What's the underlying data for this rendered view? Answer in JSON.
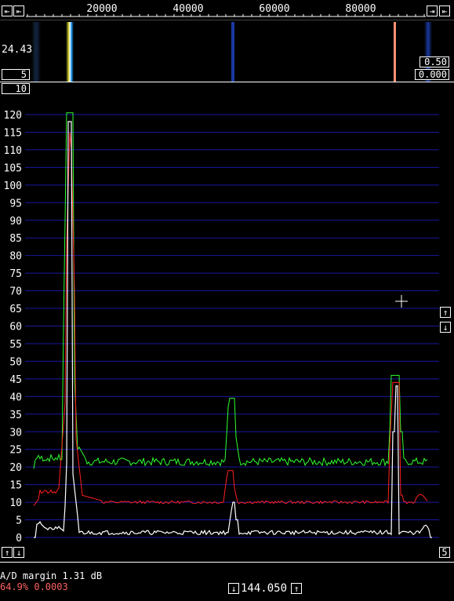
{
  "header": {
    "freq_ticks": [
      "20000",
      "40000",
      "60000",
      "80000"
    ],
    "left_buttons": [
      "⇤",
      "⇤"
    ],
    "right_buttons": [
      "⇥",
      "⇤"
    ]
  },
  "waterfall": {
    "gain_value": "24.43",
    "left_box_value": "5",
    "right_box_top": "0.50",
    "right_box_bottom": "0.000"
  },
  "spectrum": {
    "top_box": "10",
    "y_ticks": [
      "120",
      "115",
      "110",
      "105",
      "100",
      "95",
      "90",
      "85",
      "80",
      "75",
      "70",
      "65",
      "60",
      "55",
      "50",
      "45",
      "40",
      "35",
      "30",
      "25",
      "20",
      "15",
      "10",
      "5",
      "0"
    ],
    "bottom_left_value": "0",
    "bottom_right_value": "5",
    "colors": {
      "grid": "#1818a0",
      "green": "#30ff30",
      "red": "#ff2020",
      "white": "#ffffff"
    }
  },
  "status": {
    "ad_margin": "A/D margin 1.31 dB",
    "stats": "64.9% 0.0003",
    "frequency": "144.050"
  },
  "icons": {
    "up": "arrow-up-icon",
    "down": "arrow-down-icon",
    "left": "arrow-left-icon",
    "right": "arrow-right-icon"
  }
}
